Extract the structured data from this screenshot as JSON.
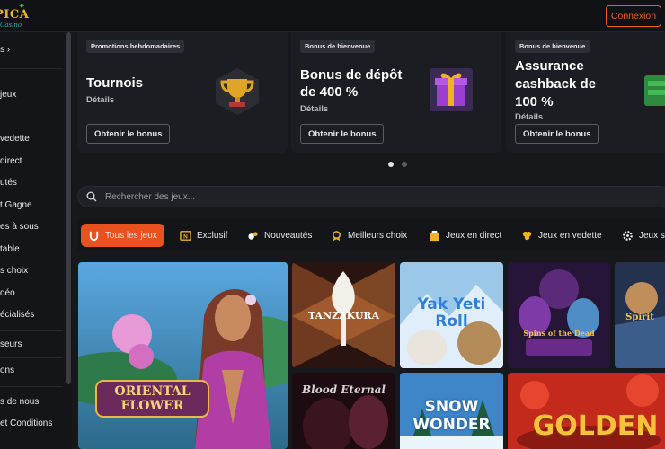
{
  "header": {
    "logo_text": "PICA",
    "logo_sub": "Casino",
    "login_label": "Connexion"
  },
  "sidebar": {
    "items": [
      {
        "label": "s ›"
      },
      {
        "label": "jeux"
      },
      {
        "label": "vedette"
      },
      {
        "label": "direct"
      },
      {
        "label": "utés"
      },
      {
        "label": "t Gagne"
      },
      {
        "label": "es à sous"
      },
      {
        "label": "table"
      },
      {
        "label": "s choix"
      },
      {
        "label": "déo"
      },
      {
        "label": "écialisés"
      },
      {
        "label": "seurs"
      },
      {
        "label": "ons"
      },
      {
        "label": "s de nous"
      },
      {
        "label": "et Conditions"
      }
    ]
  },
  "promos": [
    {
      "badge": "Promotions hebdomadaires",
      "title_line1": "Tournois",
      "title_line2": "",
      "title_line3": "",
      "details": "Détails",
      "button": "Obtenir le bonus",
      "icon": "trophy-icon"
    },
    {
      "badge": "Bonus de bienvenue",
      "title_line1": "Bonus de dépôt",
      "title_line2": "de 400 %",
      "title_line3": "",
      "details": "Détails",
      "button": "Obtenir le bonus",
      "icon": "gift-box-icon"
    },
    {
      "badge": "Bonus de bienvenue",
      "title_line1": "Assurance",
      "title_line2": "cashback de",
      "title_line3": "100 %",
      "details": "Détails",
      "button": "Obtenir le bonus",
      "icon": "cash-icon"
    }
  ],
  "carousel": {
    "total": 2,
    "active": 1
  },
  "search": {
    "placeholder": "Rechercher des jeux..."
  },
  "tabs": [
    {
      "label": "Tous les jeux",
      "icon": "horseshoe-icon",
      "active": true
    },
    {
      "label": "Exclusif",
      "icon": "exclusive-icon",
      "active": false
    },
    {
      "label": "Nouveautés",
      "icon": "new-icon",
      "active": false
    },
    {
      "label": "Meilleurs choix",
      "icon": "medal-icon",
      "active": false
    },
    {
      "label": "Jeux en direct",
      "icon": "live-icon",
      "active": false
    },
    {
      "label": "Jeux en vedette",
      "icon": "clover-icon",
      "active": false
    },
    {
      "label": "Jeux s",
      "icon": "gear-icon",
      "active": false
    }
  ],
  "games": [
    {
      "title": "ORIENTAL",
      "title2": "FLOWER"
    },
    {
      "title": "TANZAKURA",
      "title2": ""
    },
    {
      "title": "Yak Yeti",
      "title2": "Roll"
    },
    {
      "title": "Spins of the Dead",
      "title2": ""
    },
    {
      "title": "Spirit",
      "title2": ""
    },
    {
      "title": "Blood Eternal",
      "title2": ""
    },
    {
      "title": "SNOW",
      "title2": "WONDER"
    },
    {
      "title": "GOLDEN",
      "title2": ""
    }
  ],
  "colors": {
    "accent": "#e9521f",
    "background": "#17181c",
    "card": "#1c1d22"
  }
}
